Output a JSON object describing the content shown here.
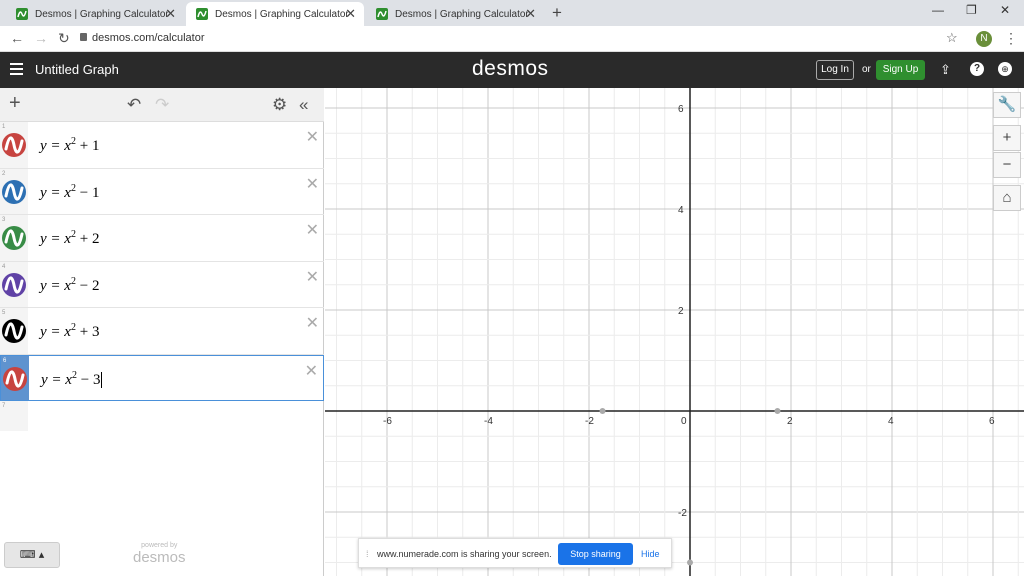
{
  "browser": {
    "tabs": [
      {
        "title": "Desmos | Graphing Calculator",
        "active": false
      },
      {
        "title": "Desmos | Graphing Calculator",
        "active": true
      },
      {
        "title": "Desmos | Graphing Calculator",
        "active": false
      }
    ],
    "url": "desmos.com/calculator",
    "profile_initial": "N"
  },
  "header": {
    "graph_title": "Untitled Graph",
    "logo": "desmos",
    "login_label": "Log In",
    "or_label": "or",
    "signup_label": "Sign Up"
  },
  "expressions": [
    {
      "index": "1",
      "lhs": "y",
      "base": "x",
      "exp": "2",
      "op": "+",
      "const": "1",
      "color": "#c74440"
    },
    {
      "index": "2",
      "lhs": "y",
      "base": "x",
      "exp": "2",
      "op": "−",
      "const": "1",
      "color": "#2d70b3"
    },
    {
      "index": "3",
      "lhs": "y",
      "base": "x",
      "exp": "2",
      "op": "+",
      "const": "2",
      "color": "#388c46"
    },
    {
      "index": "4",
      "lhs": "y",
      "base": "x",
      "exp": "2",
      "op": "−",
      "const": "2",
      "color": "#6042a6"
    },
    {
      "index": "5",
      "lhs": "y",
      "base": "x",
      "exp": "2",
      "op": "+",
      "const": "3",
      "color": "#000000"
    },
    {
      "index": "6",
      "lhs": "y",
      "base": "x",
      "exp": "2",
      "op": "−",
      "const": "3",
      "color": "#c74440"
    }
  ],
  "next_index": "7",
  "powered_by": {
    "line1": "powered by",
    "line2": "desmos"
  },
  "graph": {
    "x_ticks": [
      "-6",
      "-4",
      "-2",
      "0",
      "2",
      "4",
      "6"
    ],
    "y_ticks": [
      "6",
      "4",
      "2",
      "-2"
    ]
  },
  "share_banner": {
    "text": "www.numerade.com is sharing your screen.",
    "stop_label": "Stop sharing",
    "hide_label": "Hide"
  }
}
